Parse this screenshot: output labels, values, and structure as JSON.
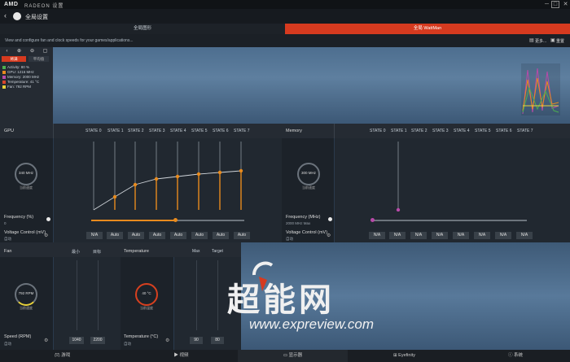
{
  "window": {
    "logo": "AMD",
    "product": "RADEON 设置"
  },
  "header": {
    "title": "全局设置"
  },
  "tabs": [
    {
      "label": "全局图形"
    },
    {
      "label": "全局 WattMan"
    }
  ],
  "infobar": {
    "description": "View and configure fan and clock speeds for your games/applications...",
    "more": "更多...",
    "reset": "重置"
  },
  "monitor": {
    "primary_button": "将满",
    "secondary_button": "平均值",
    "legend": [
      {
        "label": "Activity: 80 %",
        "color": "#4caf50"
      },
      {
        "label": "GPU: 1216 MHz",
        "color": "#e88b1e"
      },
      {
        "label": "Memory: 2000 MHz",
        "color": "#b84aa9"
      },
      {
        "label": "Temperature: 41 °C",
        "color": "#d9452b"
      },
      {
        "label": "Fan: 792 RPM",
        "color": "#e8d23a"
      }
    ]
  },
  "gpu": {
    "title": "GPU",
    "states": [
      "STATE 0",
      "STATE 1",
      "STATE 2",
      "STATE 3",
      "STATE 4",
      "STATE 5",
      "STATE 6",
      "STATE 7"
    ],
    "gauge_value": "340 MHz",
    "gauge_label": "当前速度",
    "frequency_label": "Frequency (%)",
    "frequency_value": "0",
    "voltage_label": "Voltage Control (mV)",
    "voltage_mode": "自动",
    "voltage_cells": [
      "N/A",
      "Auto",
      "Auto",
      "Auto",
      "Auto",
      "Auto",
      "Auto",
      "Auto"
    ],
    "slider_level_pct": 55
  },
  "memory": {
    "title": "Memory",
    "states": [
      "STATE 0",
      "STATE 1",
      "STATE 2",
      "STATE 3",
      "STATE 4",
      "STATE 5",
      "STATE 6",
      "STATE 7"
    ],
    "gauge_value": "300 MHz",
    "gauge_label": "当前速度",
    "frequency_label": "Frequency (MHz)",
    "frequency_value": "2000 MHz Max",
    "voltage_label": "Voltage Control (mV)",
    "voltage_mode": "自动",
    "voltage_cells": [
      "N/A",
      "N/A",
      "N/A",
      "N/A",
      "N/A",
      "N/A",
      "N/A",
      "N/A"
    ],
    "slider_level_pct": 0
  },
  "fan": {
    "title": "Fan",
    "col_min": "最小",
    "col_target": "目标",
    "gauge_value": "792 RPM",
    "gauge_label": "当前速度",
    "speed_label": "Speed (RPM)",
    "speed_mode": "自动",
    "min_value": "1040",
    "target_value": "2200"
  },
  "temperature": {
    "title": "Temperature",
    "col_max": "Max",
    "col_target": "Target",
    "gauge_value": "40 °C",
    "gauge_label": "当前温度",
    "temp_label": "Temperature (°C)",
    "temp_mode": "自动",
    "max_value": "90",
    "target_value": "80"
  },
  "watermark": {
    "text": "超能网",
    "url": "www.expreview.com"
  },
  "bottom_nav": [
    {
      "label": "游戏"
    },
    {
      "label": "视频"
    },
    {
      "label": "显示器"
    },
    {
      "label": "Eyefinity"
    },
    {
      "label": "系统"
    }
  ]
}
